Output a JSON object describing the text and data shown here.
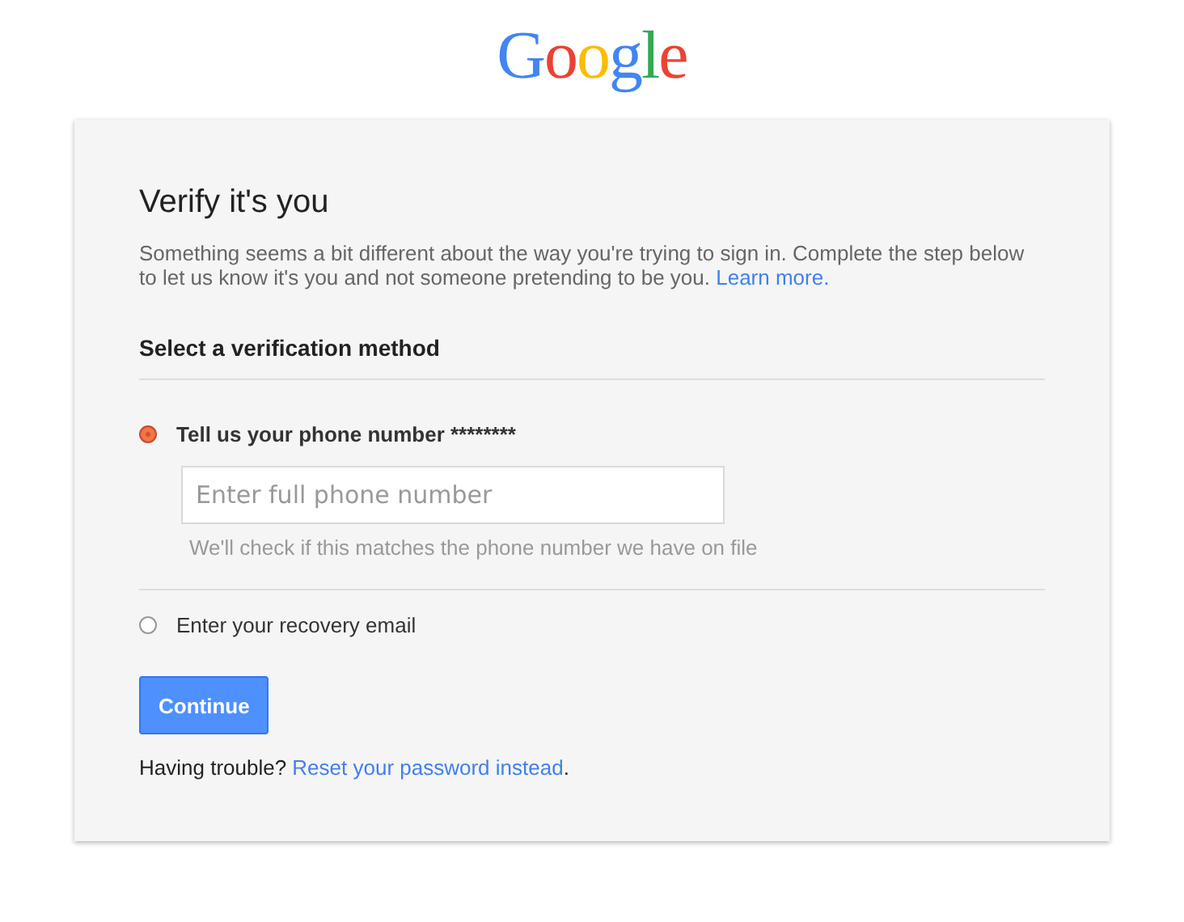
{
  "logo": [
    {
      "text": "G",
      "color": "#4285f4"
    },
    {
      "text": "o",
      "color": "#ea4335"
    },
    {
      "text": "o",
      "color": "#fbbc05"
    },
    {
      "text": "g",
      "color": "#4285f4"
    },
    {
      "text": "l",
      "color": "#34a853"
    },
    {
      "text": "e",
      "color": "#ea4335"
    }
  ],
  "title": "Verify it's you",
  "intro": "Something seems a bit different about the way you're trying to sign in. Complete the step below to let us know it's you and not someone pretending to be you.",
  "intro_link": "Learn more.",
  "section_heading": "Select a verification method",
  "options": [
    {
      "label": "Tell us your phone number ********",
      "selected": true,
      "field": {
        "placeholder": "Enter full phone number",
        "hint": "We'll check if this matches the phone number we have on file"
      }
    },
    {
      "label": "Enter your recovery email",
      "selected": false
    }
  ],
  "button": "Continue",
  "trouble": "Having trouble?",
  "trouble_link": "Reset your password instead",
  "trouble_end": "."
}
